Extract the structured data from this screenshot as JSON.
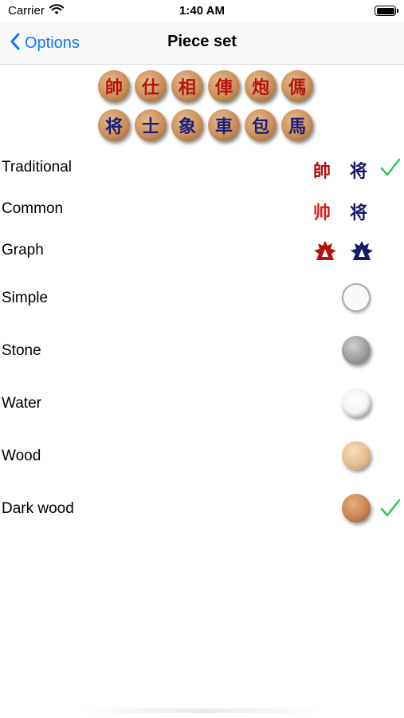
{
  "status_bar": {
    "carrier": "Carrier",
    "time": "1:40 AM"
  },
  "nav": {
    "back_label": "Options",
    "title": "Piece set"
  },
  "preview": {
    "red_row": [
      "帥",
      "仕",
      "相",
      "俥",
      "炮",
      "傌"
    ],
    "black_row": [
      "将",
      "士",
      "象",
      "車",
      "包",
      "馬"
    ]
  },
  "piece_sets": [
    {
      "label": "Traditional",
      "red": "帥",
      "black": "将",
      "selected": true
    },
    {
      "label": "Common",
      "red": "帅",
      "black": "将",
      "selected": false
    },
    {
      "label": "Graph",
      "red": "",
      "black": "",
      "selected": false
    },
    {
      "label": "Simple",
      "selected": false
    },
    {
      "label": "Stone",
      "selected": false
    },
    {
      "label": "Water",
      "selected": false
    },
    {
      "label": "Wood",
      "selected": false
    },
    {
      "label": "Dark wood",
      "selected": true
    }
  ],
  "colors": {
    "accent": "#0a7aff",
    "check": "#34c759",
    "red_piece": "#b5120e",
    "black_piece": "#17196e"
  }
}
